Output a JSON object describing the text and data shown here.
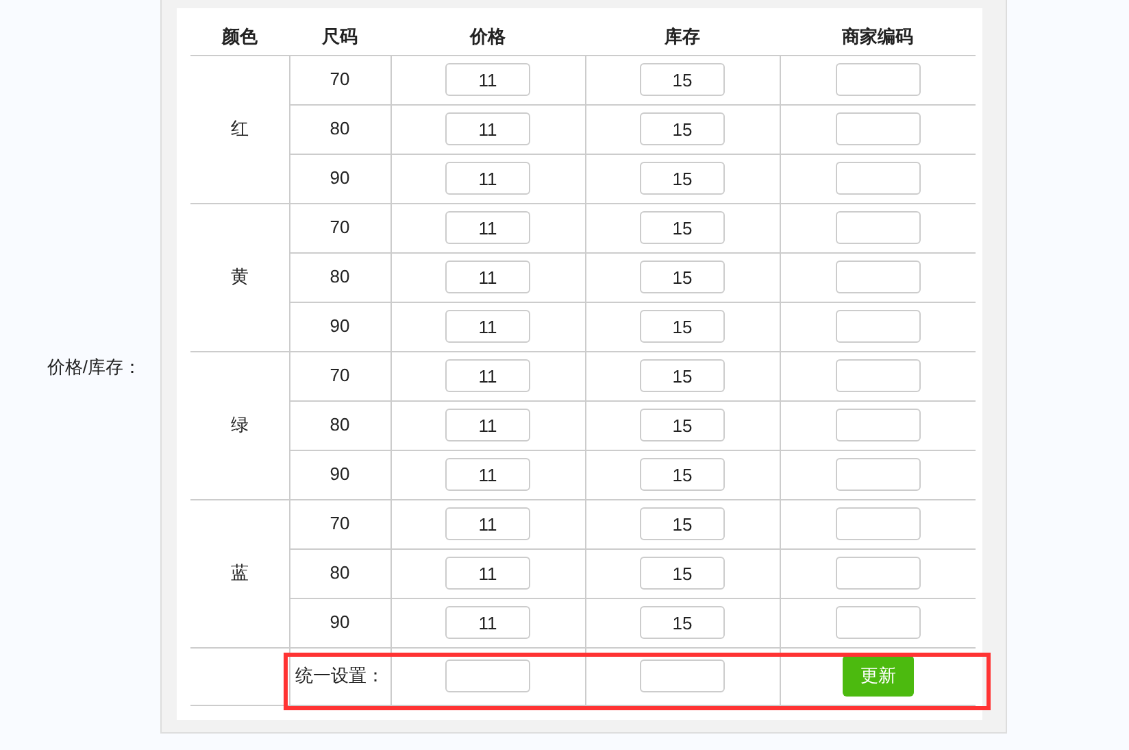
{
  "field_label": "价格/库存：",
  "columns": [
    "颜色",
    "尺码",
    "价格",
    "库存",
    "商家编码"
  ],
  "groups": [
    {
      "color_name": "红",
      "rows": [
        {
          "size": "70",
          "price": "11",
          "stock": "15"
        },
        {
          "size": "80",
          "price": "11",
          "stock": "15"
        },
        {
          "size": "90",
          "price": "11",
          "stock": "15"
        }
      ]
    },
    {
      "color_name": "黄",
      "rows": [
        {
          "size": "70",
          "price": "11",
          "stock": "15"
        },
        {
          "size": "80",
          "price": "11",
          "stock": "15"
        },
        {
          "size": "90",
          "price": "11",
          "stock": "15"
        }
      ]
    },
    {
      "color_name": "绿",
      "rows": [
        {
          "size": "70",
          "price": "11",
          "stock": "15"
        },
        {
          "size": "80",
          "price": "11",
          "stock": "15"
        },
        {
          "size": "90",
          "price": "11",
          "stock": "15"
        }
      ]
    },
    {
      "color_name": "蓝",
      "rows": [
        {
          "size": "70",
          "price": "11",
          "stock": "15"
        },
        {
          "size": "80",
          "price": "11",
          "stock": "15"
        },
        {
          "size": "90",
          "price": "11",
          "stock": "15"
        }
      ]
    }
  ],
  "batch": {
    "label": "统一设置：",
    "button": "更新",
    "highlighted": true
  }
}
